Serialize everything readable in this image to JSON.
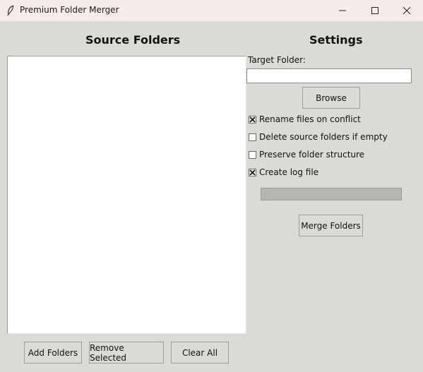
{
  "window": {
    "title": "Premium Folder Merger"
  },
  "source": {
    "heading": "Source Folders",
    "buttons": {
      "add": "Add Folders",
      "remove": "Remove Selected",
      "clear": "Clear All"
    }
  },
  "settings": {
    "heading": "Settings",
    "target_label": "Target Folder:",
    "target_value": "",
    "browse_label": "Browse",
    "options": [
      {
        "label": "Rename files on conflict",
        "checked": true
      },
      {
        "label": "Delete source folders if empty",
        "checked": false
      },
      {
        "label": "Preserve folder structure",
        "checked": false
      },
      {
        "label": "Create log file",
        "checked": true
      }
    ],
    "progress": 0,
    "merge_label": "Merge Folders"
  }
}
